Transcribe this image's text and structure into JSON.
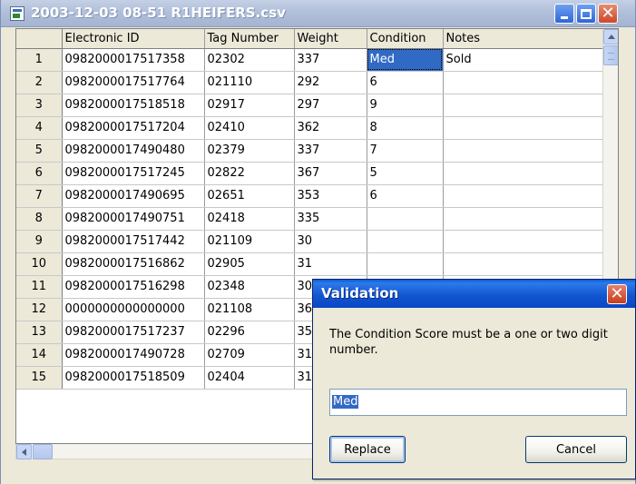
{
  "window": {
    "title": "2003-12-03 08-51 R1HEIFERS.csv"
  },
  "grid": {
    "columns": [
      "Electronic ID",
      "Tag Number",
      "Weight",
      "Condition",
      "Notes"
    ],
    "rows": [
      {
        "num": "1",
        "eid": "0982000017517358",
        "tag": "02302",
        "weight": "337",
        "condition": "Med",
        "notes": "Sold"
      },
      {
        "num": "2",
        "eid": "0982000017517764",
        "tag": "021110",
        "weight": "292",
        "condition": "6",
        "notes": ""
      },
      {
        "num": "3",
        "eid": "0982000017518518",
        "tag": "02917",
        "weight": "297",
        "condition": "9",
        "notes": ""
      },
      {
        "num": "4",
        "eid": "0982000017517204",
        "tag": "02410",
        "weight": "362",
        "condition": "8",
        "notes": ""
      },
      {
        "num": "5",
        "eid": "0982000017490480",
        "tag": "02379",
        "weight": "337",
        "condition": "7",
        "notes": ""
      },
      {
        "num": "6",
        "eid": "0982000017517245",
        "tag": "02822",
        "weight": "367",
        "condition": "5",
        "notes": ""
      },
      {
        "num": "7",
        "eid": "0982000017490695",
        "tag": "02651",
        "weight": "353",
        "condition": "6",
        "notes": ""
      },
      {
        "num": "8",
        "eid": "0982000017490751",
        "tag": "02418",
        "weight": "335",
        "condition": "",
        "notes": ""
      },
      {
        "num": "9",
        "eid": "0982000017517442",
        "tag": "021109",
        "weight": "30",
        "condition": "",
        "notes": ""
      },
      {
        "num": "10",
        "eid": "0982000017516862",
        "tag": "02905",
        "weight": "31",
        "condition": "",
        "notes": ""
      },
      {
        "num": "11",
        "eid": "0982000017516298",
        "tag": "02348",
        "weight": "30",
        "condition": "",
        "notes": ""
      },
      {
        "num": "12",
        "eid": "0000000000000000",
        "tag": "021108",
        "weight": "36",
        "condition": "",
        "notes": ""
      },
      {
        "num": "13",
        "eid": "0982000017517237",
        "tag": "02296",
        "weight": "35",
        "condition": "",
        "notes": ""
      },
      {
        "num": "14",
        "eid": "0982000017490728",
        "tag": "02709",
        "weight": "31",
        "condition": "",
        "notes": ""
      },
      {
        "num": "15",
        "eid": "0982000017518509",
        "tag": "02404",
        "weight": "31",
        "condition": "",
        "notes": ""
      }
    ],
    "selected_row": 0,
    "selected_column": "condition"
  },
  "dialog": {
    "title": "Validation",
    "message": "The Condition Score must be a one or two digit number.",
    "input_value": "Med",
    "replace_label": "Replace",
    "cancel_label": "Cancel"
  },
  "colors": {
    "selection": "#316ac5",
    "dialog_titlebar": "#1356d1",
    "window_titlebar": "#b1c0da"
  },
  "icons": {
    "app": "csv-file-icon",
    "minimize": "minimize-icon",
    "maximize": "maximize-icon",
    "close": "close-icon"
  }
}
